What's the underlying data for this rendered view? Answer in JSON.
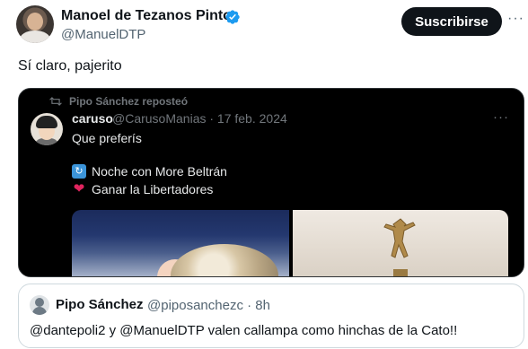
{
  "author": {
    "name": "Manoel de Tezanos Pinto",
    "handle": "@ManuelDTP",
    "subscribe_label": "Suscribirse",
    "verified_icon": "verified-badge-icon",
    "more_icon": "more-icon"
  },
  "tweet": {
    "text": "Sí claro, pajerito"
  },
  "embedded": {
    "repost_label": "Pipo Sánchez reposteó",
    "name": "caruso",
    "meta": "@CarusoManias · 17 feb. 2024",
    "question": "Que preferís",
    "option1": "Noche con More Beltrán",
    "option2": "Ganar la Libertadores",
    "option1_icon": "repeat-emoji-icon",
    "option2_icon": "heart-emoji-icon"
  },
  "quote": {
    "name": "Pipo Sánchez",
    "meta": "@piposanchezc · 8h",
    "text": "@dantepoli2 y @ManuelDTP  valen callampa como hinchas de la Cato!!"
  },
  "colors": {
    "verified": "#1d9bf0",
    "subscribe_bg": "#0f1419",
    "secondary_text": "#536471",
    "media_bg": "#000000"
  }
}
